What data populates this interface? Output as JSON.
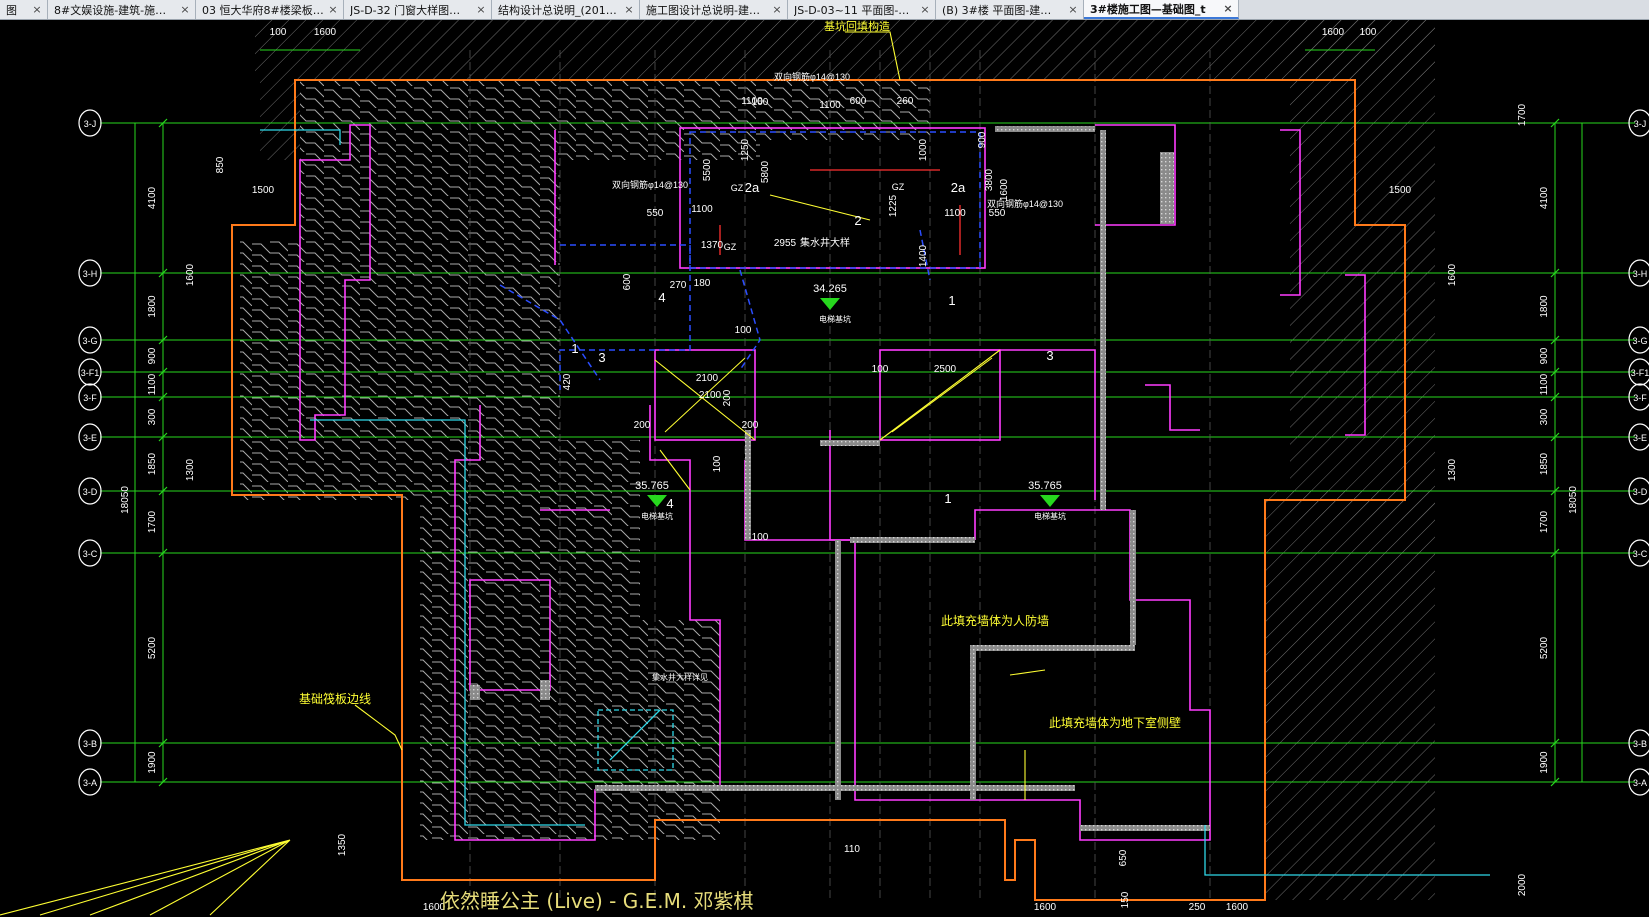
{
  "tabs": [
    {
      "label": "图",
      "active": false
    },
    {
      "label": "8#文娱设施-建筑-施…",
      "active": false
    },
    {
      "label": "03 恒大华府8#楼梁板…",
      "active": false
    },
    {
      "label": "JS-D-32 门窗大样图…",
      "active": false
    },
    {
      "label": "结构设计总说明_(201…",
      "active": false
    },
    {
      "label": "施工图设计总说明-建…",
      "active": false
    },
    {
      "label": "JS-D-03~11 平面图-…",
      "active": false
    },
    {
      "label": "(B) 3#楼 平面图-建…",
      "active": false
    },
    {
      "label": "3#楼施工图—基础图_t",
      "active": true
    }
  ],
  "tab_close_glyph": "×",
  "axes": {
    "rows": [
      "3-J",
      "3-H",
      "3-G",
      "3-F1",
      "3-F",
      "3-E",
      "3-D",
      "3-C",
      "3-B",
      "3-A"
    ],
    "total_dim": "18050",
    "left_outer_dims": [
      "4100",
      "1800",
      "900",
      "1100",
      "300",
      "1850",
      "1700",
      "5200",
      "1900"
    ],
    "left_inner_dims": [
      "850",
      "1600",
      "1300",
      "1350"
    ],
    "right_inner_dims": [
      "1700",
      "1600",
      "1300",
      "2000"
    ],
    "right_outer_dims": [
      "4100",
      "1800",
      "900",
      "1100",
      "300",
      "1850",
      "1700",
      "5200",
      "1900"
    ]
  },
  "dims": {
    "top_left": [
      "100",
      "1600"
    ],
    "top_right": [
      "1600",
      "100"
    ],
    "side_1500": "1500",
    "core": [
      "550",
      "1100",
      "1370",
      "2955",
      "180",
      "600",
      "1100",
      "100",
      "200",
      "2100",
      "2500",
      "200",
      "110",
      "550",
      "1100",
      "1000",
      "1400",
      "1225",
      "1250",
      "5500",
      "5800",
      "3800",
      "900",
      "1600",
      "270",
      "420",
      "2100",
      "200",
      "100",
      "100",
      "1100",
      "600",
      "260",
      "100",
      "100"
    ],
    "bottom": [
      "1600",
      "1600",
      "250",
      "1600",
      "150",
      "650"
    ]
  },
  "levels": [
    "34.265",
    "35.765",
    "35.765"
  ],
  "labels": {
    "raft_edge": "基础筏板边线",
    "civil_defense_wall": "此填充墙体为人防墙",
    "basement_wall": "此填充墙体为地下室侧壁",
    "top_note": "基坑回填构造",
    "sump_pit": "集水井大样",
    "pit_note": "集水井大样详见",
    "elevator_pit_label": "电梯基坑",
    "rebar_1": "双向钢筋φ14@130",
    "rebar_2": "双向钢筋φ14@130",
    "rebar_3": "双向钢筋φ14@130",
    "section_marks": [
      "1",
      "2",
      "2a",
      "2a",
      "3",
      "3",
      "4",
      "4",
      "1",
      "1"
    ],
    "gz": "GZ"
  },
  "ticker": "依然睡公主 (Live) - G.E.M. 邓紫棋",
  "colors": {
    "background": "#000000",
    "grid": "#27d81e",
    "boundary": "#ff7a1a",
    "wall": "#ff3dff",
    "hatch": "#7a7a7a",
    "cyan": "#2fd8e8",
    "blue": "#2b4dff",
    "yellow": "#ffff33",
    "white": "#ffffff"
  }
}
